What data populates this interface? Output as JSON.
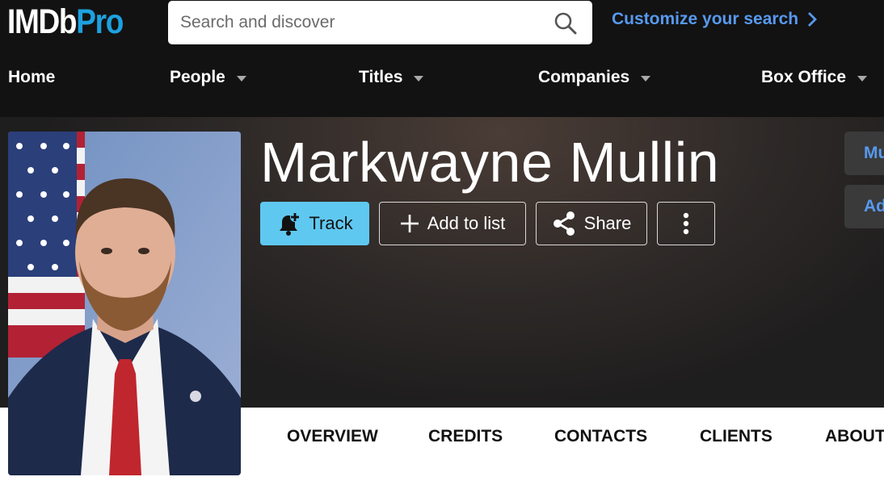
{
  "header": {
    "logo": {
      "imdb": "IMDb",
      "pro": "Pro"
    },
    "search": {
      "placeholder": "Search and discover",
      "value": ""
    },
    "customize_label": "Customize your search"
  },
  "nav": {
    "home": "Home",
    "people": "People",
    "titles": "Titles",
    "companies": "Companies",
    "box_office": "Box Office"
  },
  "profile": {
    "name": "Markwayne Mullin",
    "actions": {
      "track": "Track",
      "add_to_list": "Add to list",
      "share": "Share"
    },
    "side_buttons": [
      "Mu",
      "Ad"
    ]
  },
  "tabs": [
    "OVERVIEW",
    "CREDITS",
    "CONTACTS",
    "CLIENTS",
    "ABOUT"
  ],
  "colors": {
    "topbar": "#121212",
    "accent_blue": "#5799ef",
    "track_button": "#5fc8f0",
    "logo_pro": "#1da1e0"
  },
  "icons": {
    "search": "search-icon",
    "customize": "chevron-right-icon",
    "nav_dropdown": "caret-down-icon",
    "track": "bell-plus-icon",
    "add": "plus-icon",
    "share": "share-icon",
    "more": "kebab-menu-icon"
  }
}
